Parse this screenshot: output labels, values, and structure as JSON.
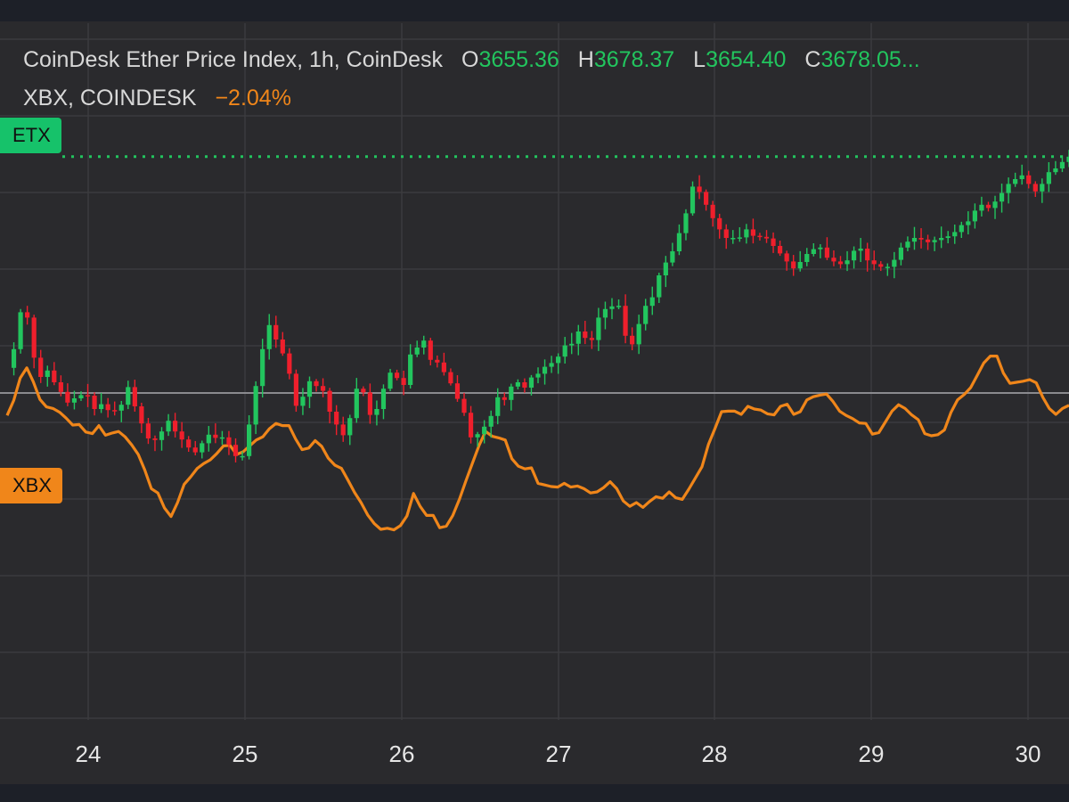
{
  "legend": {
    "line1_title": "CoinDesk Ether Price Index, 1h, CoinDesk",
    "o_label": "O",
    "o_value": "3655.36",
    "h_label": "H",
    "h_value": "3678.37",
    "l_label": "L",
    "l_value": "3654.40",
    "c_label": "C",
    "c_value": "3678.05...",
    "line2_title": "XBX, COINDESK",
    "line2_change": "−2.04%"
  },
  "tags": {
    "etx": "ETX",
    "xbx": "XBX"
  },
  "colors": {
    "background": "#2a2a2d",
    "grid": "#3b3b3f",
    "up": "#22c55e",
    "down": "#ef1f2c",
    "xbx_line": "#f0861a",
    "baseline": "#8a8a8e",
    "etx_tag": "#16c26a",
    "xbx_tag": "#f0861a",
    "tick_text": "#e6e6e6"
  },
  "chart_data": {
    "type": "line",
    "x_ticks": [
      "24",
      "25",
      "26",
      "27",
      "28",
      "29",
      "30"
    ],
    "grid": true,
    "series": [
      {
        "name": "ETX",
        "style": "candlestick",
        "note_units": "relative price level, 0 = chart bottom, 100 = chart top",
        "values": [
          56.2,
          59.7,
          66.6,
          65.6,
          58.1,
          54.5,
          55.7,
          53.5,
          51.7,
          49.7,
          50.5,
          51.1,
          51.0,
          48.5,
          49.4,
          48.3,
          48.2,
          49.3,
          52.6,
          49.0,
          45.8,
          43.0,
          42.7,
          44.3,
          46.3,
          44.3,
          42.8,
          41.3,
          40.4,
          42.1,
          43.7,
          43.1,
          43.2,
          41.8,
          39.7,
          39.7,
          45.6,
          52.8,
          59.7,
          64.2,
          61.5,
          58.9,
          55.1,
          49.1,
          50.8,
          53.7,
          52.8,
          51.9,
          48.0,
          45.6,
          43.6,
          46.8,
          52.3,
          51.6,
          47.4,
          48.5,
          52.3,
          55.3,
          54.3,
          53.0,
          58.7,
          60.0,
          61.3,
          57.7,
          57.2,
          55.4,
          53.3,
          50.4,
          47.8,
          43.2,
          43.8,
          45.2,
          47.2,
          50.7,
          50.2,
          52.7,
          53.5,
          52.5,
          54.4,
          55.1,
          56.4,
          57.1,
          58.3,
          60.4,
          60.7,
          63.0,
          61.8,
          61.4,
          65.6,
          67.2,
          67.7,
          67.8,
          62.2,
          60.6,
          64.4,
          67.8,
          69.4,
          73.5,
          75.9,
          78.0,
          81.4,
          85.1,
          90.1,
          89.1,
          86.7,
          84.2,
          82.1,
          80.5,
          80.5,
          80.6,
          82.1,
          80.9,
          80.7,
          80.4,
          79.0,
          77.6,
          76.1,
          74.8,
          76.0,
          77.5,
          78.4,
          78.7,
          76.8,
          76.1,
          75.6,
          76.3,
          78.1,
          78.5,
          76.3,
          75.6,
          75.1,
          75.1,
          76.4,
          78.7,
          79.8,
          80.5,
          80.2,
          79.7,
          80.1,
          80.5,
          80.8,
          81.6,
          82.9,
          83.6,
          85.6,
          86.7,
          86.1,
          87.3,
          88.9,
          90.6,
          91.5,
          92.2,
          90.6,
          89.2,
          90.6,
          92.8,
          93.5,
          94.7,
          95.7
        ]
      },
      {
        "name": "XBX",
        "style": "line",
        "note_units": "relative price level, 0 = chart bottom, 100 = chart top",
        "values": [
          47.3,
          50.1,
          54.3,
          56.2,
          53.6,
          50.3,
          48.9,
          48.6,
          47.9,
          46.8,
          45.5,
          45.6,
          44.2,
          43.9,
          45.4,
          43.6,
          44.0,
          44.3,
          43.3,
          41.8,
          40.0,
          37.1,
          33.6,
          32.8,
          30.0,
          28.4,
          31.0,
          34.4,
          35.8,
          37.4,
          38.3,
          39.0,
          40.2,
          41.6,
          41.7,
          40.0,
          40.5,
          41.6,
          42.7,
          43.3,
          44.8,
          45.8,
          45.4,
          45.4,
          42.9,
          40.9,
          41.2,
          42.6,
          41.5,
          39.3,
          38.0,
          37.4,
          35.2,
          32.9,
          31.0,
          28.7,
          27.1,
          26.0,
          26.2,
          25.9,
          26.7,
          28.5,
          32.7,
          30.3,
          28.6,
          28.6,
          26.3,
          26.6,
          28.6,
          31.6,
          35.1,
          38.4,
          41.7,
          44.3,
          43.4,
          43.1,
          42.7,
          39.2,
          37.8,
          37.3,
          37.5,
          34.6,
          34.3,
          34.0,
          33.9,
          34.6,
          33.9,
          34.1,
          33.6,
          32.8,
          33.0,
          33.8,
          34.9,
          33.6,
          31.3,
          30.3,
          31.0,
          30.1,
          31.2,
          32.1,
          31.8,
          33.0,
          31.9,
          31.6,
          33.5,
          35.6,
          37.7,
          41.9,
          44.9,
          48.0,
          48.1,
          48.1,
          47.5,
          49.0,
          48.5,
          48.3,
          47.6,
          47.4,
          49.0,
          49.4,
          47.5,
          48.0,
          50.2,
          50.8,
          51.1,
          51.3,
          49.9,
          48.1,
          47.3,
          46.7,
          45.9,
          45.8,
          43.8,
          44.1,
          46.1,
          48.1,
          49.3,
          48.6,
          47.4,
          46.5,
          43.9,
          43.5,
          43.7,
          44.6,
          47.9,
          50.2,
          51.2,
          52.5,
          54.8,
          57.1,
          58.4,
          58.4,
          55.2,
          53.3,
          53.5,
          53.7,
          54.0,
          53.4,
          50.7,
          48.6,
          47.5,
          48.6,
          49.2
        ]
      }
    ],
    "reference_lines": [
      {
        "series": "ETX",
        "style": "dotted",
        "value": 95.7
      },
      {
        "series": "baseline",
        "style": "solid",
        "value": 51.5
      }
    ]
  }
}
